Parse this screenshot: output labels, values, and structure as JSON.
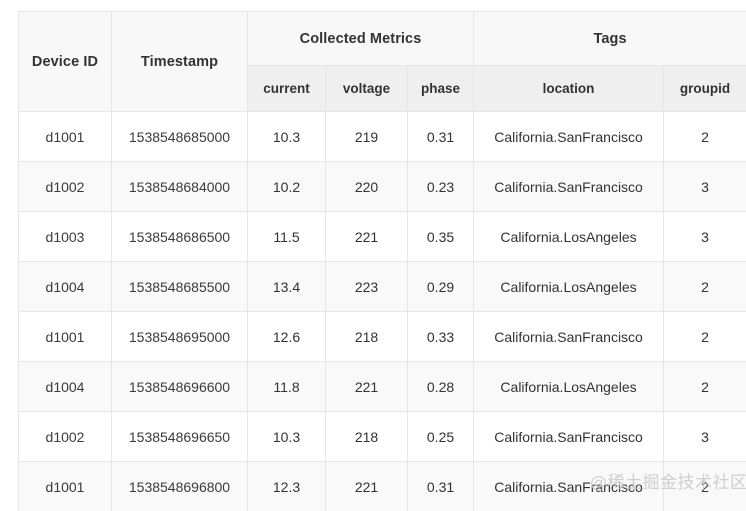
{
  "table": {
    "group_headers": [
      {
        "label": "Device ID",
        "rowspan": true
      },
      {
        "label": "Timestamp",
        "rowspan": true
      },
      {
        "label": "Collected Metrics",
        "colspan": 3
      },
      {
        "label": "Tags",
        "colspan": 2
      }
    ],
    "sub_headers": [
      "current",
      "voltage",
      "phase",
      "location",
      "groupid"
    ],
    "columns": [
      "Device ID",
      "Timestamp",
      "current",
      "voltage",
      "phase",
      "location",
      "groupid"
    ],
    "rows": [
      {
        "device_id": "d1001",
        "timestamp": "1538548685000",
        "current": "10.3",
        "voltage": "219",
        "phase": "0.31",
        "location": "California.SanFrancisco",
        "groupid": "2"
      },
      {
        "device_id": "d1002",
        "timestamp": "1538548684000",
        "current": "10.2",
        "voltage": "220",
        "phase": "0.23",
        "location": "California.SanFrancisco",
        "groupid": "3"
      },
      {
        "device_id": "d1003",
        "timestamp": "1538548686500",
        "current": "11.5",
        "voltage": "221",
        "phase": "0.35",
        "location": "California.LosAngeles",
        "groupid": "3"
      },
      {
        "device_id": "d1004",
        "timestamp": "1538548685500",
        "current": "13.4",
        "voltage": "223",
        "phase": "0.29",
        "location": "California.LosAngeles",
        "groupid": "2"
      },
      {
        "device_id": "d1001",
        "timestamp": "1538548695000",
        "current": "12.6",
        "voltage": "218",
        "phase": "0.33",
        "location": "California.SanFrancisco",
        "groupid": "2"
      },
      {
        "device_id": "d1004",
        "timestamp": "1538548696600",
        "current": "11.8",
        "voltage": "221",
        "phase": "0.28",
        "location": "California.LosAngeles",
        "groupid": "2"
      },
      {
        "device_id": "d1002",
        "timestamp": "1538548696650",
        "current": "10.3",
        "voltage": "218",
        "phase": "0.25",
        "location": "California.SanFrancisco",
        "groupid": "3"
      },
      {
        "device_id": "d1001",
        "timestamp": "1538548696800",
        "current": "12.3",
        "voltage": "221",
        "phase": "0.31",
        "location": "California.SanFrancisco",
        "groupid": "2"
      }
    ]
  },
  "watermark": {
    "text": "@稀土掘金技术社区"
  },
  "colors": {
    "group_header_bg": "#f8f8f8",
    "sub_header_bg": "#efefef",
    "row_bg": "#ffffff",
    "row_alt_bg": "#f9f9f9",
    "border": "#e6e6e6",
    "text": "#333333",
    "watermark": "#c8c8c8"
  }
}
